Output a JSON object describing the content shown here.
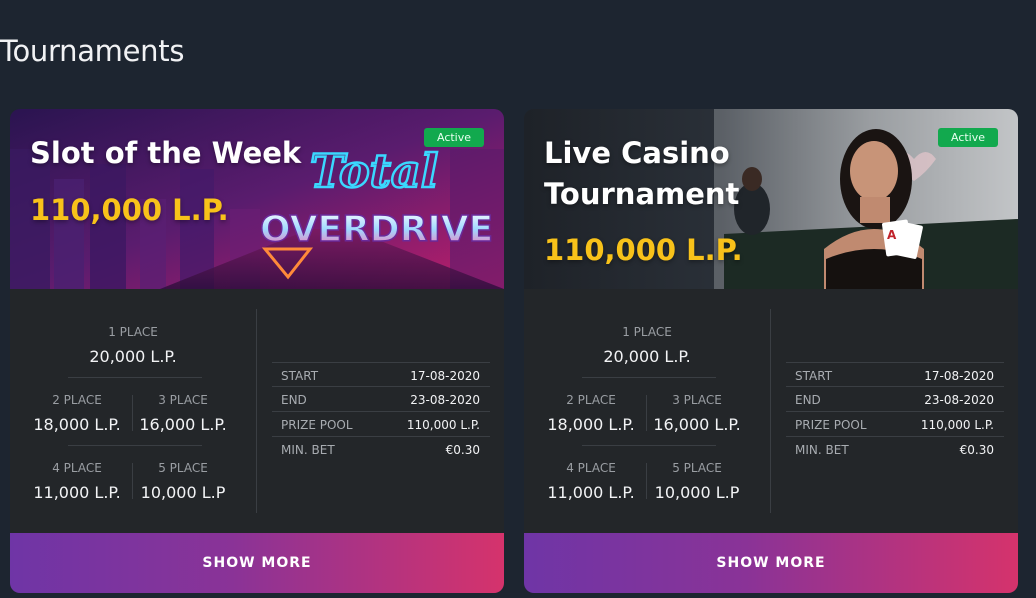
{
  "page": {
    "title": "Tournaments"
  },
  "cards": [
    {
      "title": "Slot of the Week",
      "prize": "110,000 L.P.",
      "status": "Active",
      "art_text": [
        "Total",
        "OVERDRIVE"
      ],
      "places": [
        {
          "label": "1 PLACE",
          "value": "20,000 L.P."
        },
        {
          "label": "2 PLACE",
          "value": "18,000 L.P."
        },
        {
          "label": "3 PLACE",
          "value": "16,000 L.P."
        },
        {
          "label": "4 PLACE",
          "value": "11,000 L.P."
        },
        {
          "label": "5 PLACE",
          "value": "10,000 L.P"
        }
      ],
      "info": [
        {
          "key": "START",
          "value": "17-08-2020"
        },
        {
          "key": "END",
          "value": "23-08-2020"
        },
        {
          "key": "PRIZE POOL",
          "value": "110,000 L.P."
        },
        {
          "key": "MIN. BET",
          "value": "€0.30"
        }
      ],
      "button": "SHOW MORE"
    },
    {
      "title_lines": [
        "Live Casino",
        "Tournament"
      ],
      "prize": "110,000 L.P.",
      "status": "Active",
      "places": [
        {
          "label": "1 PLACE",
          "value": "20,000 L.P."
        },
        {
          "label": "2 PLACE",
          "value": "18,000 L.P."
        },
        {
          "label": "3 PLACE",
          "value": "16,000 L.P."
        },
        {
          "label": "4 PLACE",
          "value": "11,000 L.P."
        },
        {
          "label": "5 PLACE",
          "value": "10,000 L.P"
        }
      ],
      "info": [
        {
          "key": "START",
          "value": "17-08-2020"
        },
        {
          "key": "END",
          "value": "23-08-2020"
        },
        {
          "key": "PRIZE POOL",
          "value": "110,000 L.P."
        },
        {
          "key": "MIN. BET",
          "value": "€0.30"
        }
      ],
      "button": "SHOW MORE"
    }
  ],
  "colors": {
    "background": "#1d2530",
    "card": "#232629",
    "prize": "#f8c21a",
    "badge": "#12a94e",
    "button_start": "#6f35a6",
    "button_end": "#d5336c"
  }
}
